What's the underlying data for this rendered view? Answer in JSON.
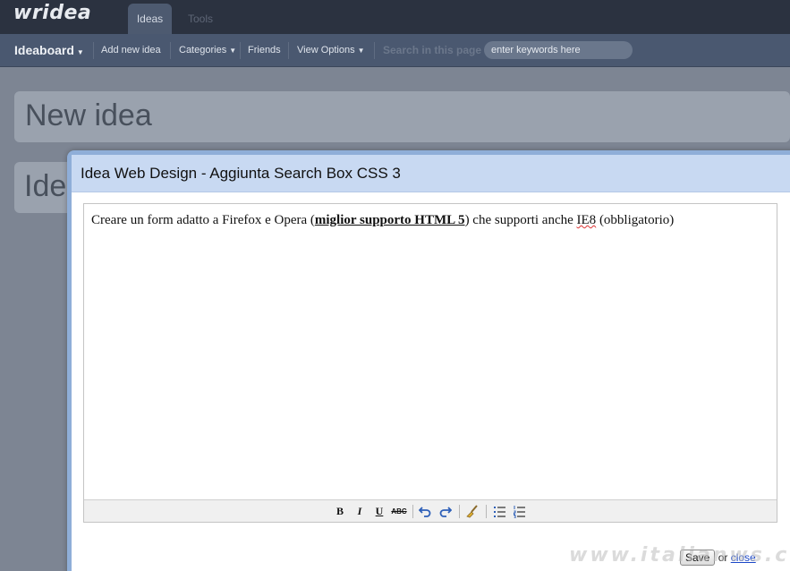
{
  "app": {
    "logo": "wridea"
  },
  "top_tabs": [
    {
      "label": "Ideas",
      "active": true
    },
    {
      "label": "Tools",
      "active": false
    }
  ],
  "nav": {
    "brand": "Ideaboard",
    "add_new": "Add new idea",
    "categories": "Categories",
    "friends": "Friends",
    "view_options": "View Options",
    "search_label": "Search in this page",
    "search_placeholder": "enter keywords here"
  },
  "panels": {
    "new_idea": "New idea",
    "ideas": "Ide"
  },
  "modal": {
    "title": "Idea Web Design - Aggiunta Search Box CSS 3",
    "body": {
      "before": "Creare un form adatto a Firefox e Opera (",
      "bold": "miglior supporto HTML 5",
      "after_bold": ") che supporti anche ",
      "spell": "IE8",
      "end": " (obbligatorio)"
    },
    "toolbar": {
      "bold": "B",
      "italic": "I",
      "underline": "U",
      "strike": "ABC"
    },
    "save_label": "Save",
    "or_text": "or",
    "close_label": "close"
  },
  "watermark": "www.italianws.com",
  "colors": {
    "topbar": "#2b3240",
    "navbar": "#4a5870",
    "modal_header": "#c8d9f2",
    "modal_border": "#8faed8",
    "link": "#1a47c8"
  }
}
